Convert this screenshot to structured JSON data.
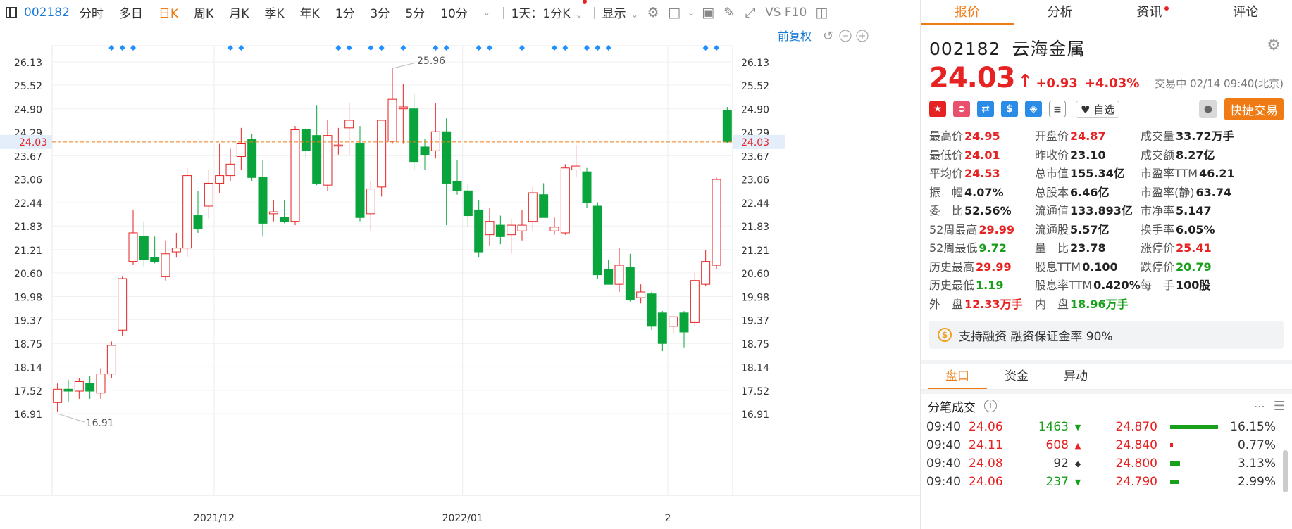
{
  "toolbar": {
    "code": "002182",
    "periods": [
      "分时",
      "多日",
      "日K",
      "周K",
      "月K",
      "季K",
      "年K",
      "1分",
      "3分",
      "5分",
      "10分"
    ],
    "active_period": "日K",
    "multi_period": "1天：1分K",
    "display_label": "显示",
    "f10_label": "VS F10"
  },
  "chart": {
    "right_adjust_label": "前复权",
    "price_ticks": [
      "26.13",
      "25.52",
      "24.90",
      "24.29",
      "23.67",
      "23.06",
      "22.44",
      "21.83",
      "21.21",
      "20.60",
      "19.98",
      "19.37",
      "18.75",
      "18.14",
      "17.52",
      "16.91"
    ],
    "current_price": "24.03",
    "x_labels": [
      "2021/12",
      "2022/01",
      "2"
    ],
    "high_label": "25.96",
    "low_label": "16.91"
  },
  "chart_data": {
    "type": "candlestick",
    "ylim": [
      16.6,
      26.5
    ],
    "current_line": 24.03,
    "annot_high": 25.96,
    "annot_low": 16.91,
    "x_tick_index": [
      15,
      38,
      57
    ],
    "marker_index": [
      5,
      6,
      7,
      16,
      17,
      26,
      27,
      29,
      30,
      32,
      35,
      36,
      39,
      40,
      43,
      46,
      47,
      49,
      50,
      51,
      60,
      61
    ],
    "ohlc": [
      [
        17.2,
        17.7,
        16.95,
        17.55
      ],
      [
        17.55,
        17.8,
        17.2,
        17.5
      ],
      [
        17.5,
        17.85,
        17.3,
        17.75
      ],
      [
        17.7,
        17.9,
        17.3,
        17.5
      ],
      [
        17.45,
        18.1,
        17.3,
        17.95
      ],
      [
        17.95,
        18.8,
        17.85,
        18.7
      ],
      [
        19.1,
        20.5,
        18.95,
        20.45
      ],
      [
        20.9,
        22.25,
        20.8,
        21.65
      ],
      [
        21.55,
        21.95,
        20.75,
        20.95
      ],
      [
        21.0,
        21.55,
        20.85,
        20.9
      ],
      [
        20.5,
        21.45,
        20.4,
        21.1
      ],
      [
        21.15,
        21.65,
        21.0,
        21.25
      ],
      [
        21.25,
        23.35,
        21.0,
        23.15
      ],
      [
        22.1,
        22.75,
        21.65,
        21.75
      ],
      [
        22.35,
        23.3,
        22.0,
        22.95
      ],
      [
        22.95,
        24.0,
        22.7,
        23.15
      ],
      [
        23.15,
        23.85,
        23.0,
        23.45
      ],
      [
        23.65,
        24.4,
        23.3,
        24.0
      ],
      [
        24.1,
        24.25,
        23.0,
        23.1
      ],
      [
        23.1,
        23.55,
        21.55,
        21.9
      ],
      [
        22.15,
        22.5,
        21.95,
        22.2
      ],
      [
        22.05,
        22.5,
        21.9,
        21.95
      ],
      [
        21.95,
        24.45,
        21.85,
        24.35
      ],
      [
        24.35,
        24.4,
        23.6,
        23.8
      ],
      [
        24.2,
        25.0,
        22.9,
        22.95
      ],
      [
        22.9,
        24.6,
        22.75,
        24.2
      ],
      [
        23.95,
        24.4,
        23.7,
        23.95
      ],
      [
        24.4,
        25.05,
        23.7,
        24.6
      ],
      [
        24.0,
        24.45,
        21.95,
        22.05
      ],
      [
        22.15,
        23.0,
        21.7,
        22.8
      ],
      [
        22.85,
        24.45,
        22.6,
        24.6
      ],
      [
        24.05,
        25.96,
        24.0,
        25.15
      ],
      [
        24.9,
        25.55,
        24.0,
        24.95
      ],
      [
        24.9,
        25.3,
        23.3,
        23.5
      ],
      [
        23.9,
        24.1,
        23.3,
        23.7
      ],
      [
        23.8,
        25.05,
        23.6,
        24.3
      ],
      [
        24.3,
        24.65,
        21.85,
        22.95
      ],
      [
        23.0,
        23.55,
        22.65,
        22.75
      ],
      [
        22.75,
        22.95,
        21.8,
        22.1
      ],
      [
        22.25,
        22.5,
        21.0,
        21.15
      ],
      [
        21.6,
        22.3,
        21.3,
        21.95
      ],
      [
        21.85,
        22.1,
        21.35,
        21.55
      ],
      [
        21.6,
        22.0,
        21.1,
        21.85
      ],
      [
        21.7,
        22.25,
        21.45,
        21.85
      ],
      [
        21.95,
        22.85,
        21.7,
        22.7
      ],
      [
        22.65,
        22.95,
        22.05,
        22.05
      ],
      [
        21.7,
        22.05,
        21.6,
        21.8
      ],
      [
        21.65,
        23.45,
        21.6,
        23.35
      ],
      [
        23.3,
        23.95,
        23.1,
        23.4
      ],
      [
        23.25,
        23.35,
        22.3,
        22.45
      ],
      [
        22.35,
        22.45,
        20.45,
        20.55
      ],
      [
        20.7,
        20.95,
        20.4,
        20.3
      ],
      [
        20.3,
        21.25,
        20.1,
        20.8
      ],
      [
        20.75,
        21.1,
        19.85,
        19.9
      ],
      [
        19.95,
        20.3,
        19.8,
        20.1
      ],
      [
        20.05,
        20.1,
        19.1,
        19.2
      ],
      [
        19.55,
        19.6,
        18.55,
        18.75
      ],
      [
        19.2,
        19.4,
        19.0,
        19.45
      ],
      [
        19.55,
        19.6,
        18.65,
        19.05
      ],
      [
        19.3,
        20.6,
        19.2,
        20.4
      ],
      [
        20.3,
        21.2,
        20.25,
        20.9
      ],
      [
        20.8,
        23.1,
        20.7,
        23.05
      ],
      [
        24.85,
        24.95,
        24.01,
        24.03
      ]
    ]
  },
  "quote": {
    "tabs": [
      "报价",
      "分析",
      "资讯",
      "评论"
    ],
    "code": "002182",
    "name": "云海金属",
    "price": "24.03",
    "change": "+0.93",
    "change_pct": "+4.03%",
    "status": "交易中 02/14 09:40(北京)",
    "watch_label": "自选",
    "quick_trade_label": "快捷交易",
    "stats": [
      {
        "label": "最高价",
        "value": "24.95",
        "color": "red"
      },
      {
        "label": "开盘价",
        "value": "24.87",
        "color": "red"
      },
      {
        "label": "成交量",
        "value": "33.72万手",
        "color": "dark"
      },
      {
        "label": "最低价",
        "value": "24.01",
        "color": "red"
      },
      {
        "label": "昨收价",
        "value": "23.10",
        "color": "dark"
      },
      {
        "label": "成交额",
        "value": "8.27亿",
        "color": "dark"
      },
      {
        "label": "平均价",
        "value": "24.53",
        "color": "red"
      },
      {
        "label": "总市值",
        "value": "155.34亿",
        "color": "dark"
      },
      {
        "label": "市盈率TTM",
        "value": "46.21",
        "color": "dark"
      },
      {
        "label": "振　幅",
        "value": "4.07%",
        "color": "dark"
      },
      {
        "label": "总股本",
        "value": "6.46亿",
        "color": "dark"
      },
      {
        "label": "市盈率(静)",
        "value": "63.74",
        "color": "dark"
      },
      {
        "label": "委　比",
        "value": "52.56%",
        "color": "dark"
      },
      {
        "label": "流通值",
        "value": "133.893亿",
        "color": "dark"
      },
      {
        "label": "市净率",
        "value": "5.147",
        "color": "dark"
      },
      {
        "label": "52周最高",
        "value": "29.99",
        "color": "red"
      },
      {
        "label": "流通股",
        "value": "5.57亿",
        "color": "dark"
      },
      {
        "label": "换手率",
        "value": "6.05%",
        "color": "dark"
      },
      {
        "label": "52周最低",
        "value": "9.72",
        "color": "green"
      },
      {
        "label": "量　比",
        "value": "23.78",
        "color": "dark"
      },
      {
        "label": "涨停价",
        "value": "25.41",
        "color": "red"
      },
      {
        "label": "历史最高",
        "value": "29.99",
        "color": "red"
      },
      {
        "label": "股息TTM",
        "value": "0.100",
        "color": "dark"
      },
      {
        "label": "跌停价",
        "value": "20.79",
        "color": "green"
      },
      {
        "label": "历史最低",
        "value": "1.19",
        "color": "green"
      },
      {
        "label": "股息率TTM",
        "value": "0.420%",
        "color": "dark"
      },
      {
        "label": "每　手",
        "value": "100股",
        "color": "dark"
      },
      {
        "label": "外　盘",
        "value": "12.33万手",
        "color": "red"
      },
      {
        "label": "内　盘",
        "value": "18.96万手",
        "color": "green"
      }
    ],
    "margin_text": "支持融资 融资保证金率 90%",
    "sub_tabs": [
      "盘口",
      "资金",
      "异动"
    ],
    "ticks_title": "分笔成交",
    "ticks": [
      {
        "time": "09:40",
        "price": "24.06",
        "vol": "1463",
        "dir": "down",
        "level": "24.870",
        "pct": "16.15%",
        "frac": 0.95,
        "barcolor": "green"
      },
      {
        "time": "09:40",
        "price": "24.11",
        "vol": "608",
        "dir": "up",
        "level": "24.840",
        "pct": "0.77%",
        "frac": 0.05,
        "barcolor": "red"
      },
      {
        "time": "09:40",
        "price": "24.08",
        "vol": "92",
        "dir": "flat",
        "level": "24.800",
        "pct": "3.13%",
        "frac": 0.2,
        "barcolor": "green"
      },
      {
        "time": "09:40",
        "price": "24.06",
        "vol": "237",
        "dir": "down",
        "level": "24.790",
        "pct": "2.99%",
        "frac": 0.18,
        "barcolor": "green"
      }
    ]
  }
}
